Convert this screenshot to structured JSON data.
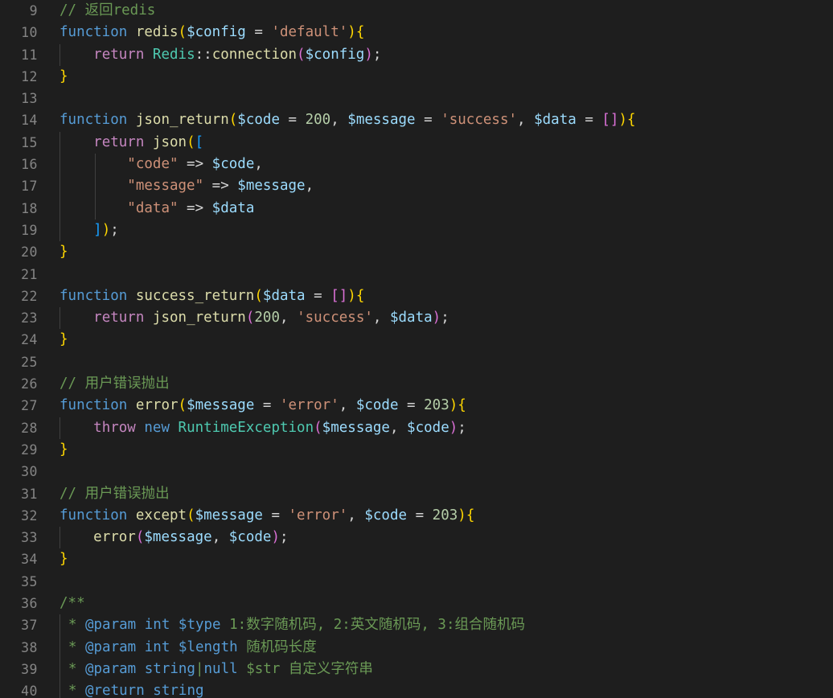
{
  "editor": {
    "language": "php",
    "theme": "Dark Modern",
    "background_color": "#1e1e1e",
    "line_number_color": "#858585",
    "indent_guide_color": "#404040",
    "first_visible_line": 9,
    "last_visible_line": 40,
    "bracket_colors": [
      "#ffd700",
      "#da70d6",
      "#179fff"
    ],
    "token_colors": {
      "comment": "#6a9955",
      "keyword": "#569cd6",
      "control": "#c586c0",
      "function": "#dcdcaa",
      "class": "#4ec9b0",
      "variable": "#9cdcfe",
      "string": "#ce9178",
      "number": "#b5cea8",
      "plain": "#d4d4d4"
    }
  },
  "lines": [
    {
      "num": "9",
      "indent": 0,
      "tokens": [
        {
          "c": "t-comment",
          "t": "// 返回redis"
        }
      ]
    },
    {
      "num": "10",
      "indent": 0,
      "tokens": [
        {
          "c": "t-keyword",
          "t": "function"
        },
        {
          "c": "t-plain",
          "t": " "
        },
        {
          "c": "t-func",
          "t": "redis"
        },
        {
          "c": "b1",
          "t": "("
        },
        {
          "c": "t-var",
          "t": "$config"
        },
        {
          "c": "t-plain",
          "t": " = "
        },
        {
          "c": "t-string",
          "t": "'default'"
        },
        {
          "c": "b1",
          "t": ")"
        },
        {
          "c": "b1",
          "t": "{"
        }
      ]
    },
    {
      "num": "11",
      "indent": 1,
      "tokens": [
        {
          "c": "t-plain",
          "t": "    "
        },
        {
          "c": "t-control",
          "t": "return"
        },
        {
          "c": "t-plain",
          "t": " "
        },
        {
          "c": "t-class",
          "t": "Redis"
        },
        {
          "c": "t-plain",
          "t": "::"
        },
        {
          "c": "t-func",
          "t": "connection"
        },
        {
          "c": "b2",
          "t": "("
        },
        {
          "c": "t-var",
          "t": "$config"
        },
        {
          "c": "b2",
          "t": ")"
        },
        {
          "c": "t-plain",
          "t": ";"
        }
      ]
    },
    {
      "num": "12",
      "indent": 0,
      "tokens": [
        {
          "c": "b1",
          "t": "}"
        }
      ]
    },
    {
      "num": "13",
      "indent": 0,
      "tokens": []
    },
    {
      "num": "14",
      "indent": 0,
      "tokens": [
        {
          "c": "t-keyword",
          "t": "function"
        },
        {
          "c": "t-plain",
          "t": " "
        },
        {
          "c": "t-func",
          "t": "json_return"
        },
        {
          "c": "b1",
          "t": "("
        },
        {
          "c": "t-var",
          "t": "$code"
        },
        {
          "c": "t-plain",
          "t": " = "
        },
        {
          "c": "t-number",
          "t": "200"
        },
        {
          "c": "t-plain",
          "t": ", "
        },
        {
          "c": "t-var",
          "t": "$message"
        },
        {
          "c": "t-plain",
          "t": " = "
        },
        {
          "c": "t-string",
          "t": "'success'"
        },
        {
          "c": "t-plain",
          "t": ", "
        },
        {
          "c": "t-var",
          "t": "$data"
        },
        {
          "c": "t-plain",
          "t": " = "
        },
        {
          "c": "b2",
          "t": "[]"
        },
        {
          "c": "b1",
          "t": ")"
        },
        {
          "c": "b1",
          "t": "{"
        }
      ]
    },
    {
      "num": "15",
      "indent": 1,
      "tokens": [
        {
          "c": "t-plain",
          "t": "    "
        },
        {
          "c": "t-control",
          "t": "return"
        },
        {
          "c": "t-plain",
          "t": " "
        },
        {
          "c": "t-func",
          "t": "json"
        },
        {
          "c": "b1",
          "t": "("
        },
        {
          "c": "b3",
          "t": "["
        }
      ]
    },
    {
      "num": "16",
      "indent": 2,
      "tokens": [
        {
          "c": "t-plain",
          "t": "        "
        },
        {
          "c": "t-string",
          "t": "\"code\""
        },
        {
          "c": "t-plain",
          "t": " => "
        },
        {
          "c": "t-var",
          "t": "$code"
        },
        {
          "c": "t-plain",
          "t": ","
        }
      ]
    },
    {
      "num": "17",
      "indent": 2,
      "tokens": [
        {
          "c": "t-plain",
          "t": "        "
        },
        {
          "c": "t-string",
          "t": "\"message\""
        },
        {
          "c": "t-plain",
          "t": " => "
        },
        {
          "c": "t-var",
          "t": "$message"
        },
        {
          "c": "t-plain",
          "t": ","
        }
      ]
    },
    {
      "num": "18",
      "indent": 2,
      "tokens": [
        {
          "c": "t-plain",
          "t": "        "
        },
        {
          "c": "t-string",
          "t": "\"data\""
        },
        {
          "c": "t-plain",
          "t": " => "
        },
        {
          "c": "t-var",
          "t": "$data"
        }
      ]
    },
    {
      "num": "19",
      "indent": 1,
      "tokens": [
        {
          "c": "t-plain",
          "t": "    "
        },
        {
          "c": "b3",
          "t": "]"
        },
        {
          "c": "b1",
          "t": ")"
        },
        {
          "c": "t-plain",
          "t": ";"
        }
      ]
    },
    {
      "num": "20",
      "indent": 0,
      "tokens": [
        {
          "c": "b1",
          "t": "}"
        }
      ]
    },
    {
      "num": "21",
      "indent": 0,
      "tokens": []
    },
    {
      "num": "22",
      "indent": 0,
      "tokens": [
        {
          "c": "t-keyword",
          "t": "function"
        },
        {
          "c": "t-plain",
          "t": " "
        },
        {
          "c": "t-func",
          "t": "success_return"
        },
        {
          "c": "b1",
          "t": "("
        },
        {
          "c": "t-var",
          "t": "$data"
        },
        {
          "c": "t-plain",
          "t": " = "
        },
        {
          "c": "b2",
          "t": "[]"
        },
        {
          "c": "b1",
          "t": ")"
        },
        {
          "c": "b1",
          "t": "{"
        }
      ]
    },
    {
      "num": "23",
      "indent": 1,
      "tokens": [
        {
          "c": "t-plain",
          "t": "    "
        },
        {
          "c": "t-control",
          "t": "return"
        },
        {
          "c": "t-plain",
          "t": " "
        },
        {
          "c": "t-func",
          "t": "json_return"
        },
        {
          "c": "b2",
          "t": "("
        },
        {
          "c": "t-number",
          "t": "200"
        },
        {
          "c": "t-plain",
          "t": ", "
        },
        {
          "c": "t-string",
          "t": "'success'"
        },
        {
          "c": "t-plain",
          "t": ", "
        },
        {
          "c": "t-var",
          "t": "$data"
        },
        {
          "c": "b2",
          "t": ")"
        },
        {
          "c": "t-plain",
          "t": ";"
        }
      ]
    },
    {
      "num": "24",
      "indent": 0,
      "tokens": [
        {
          "c": "b1",
          "t": "}"
        }
      ]
    },
    {
      "num": "25",
      "indent": 0,
      "tokens": []
    },
    {
      "num": "26",
      "indent": 0,
      "tokens": [
        {
          "c": "t-comment",
          "t": "// 用户错误抛出"
        }
      ]
    },
    {
      "num": "27",
      "indent": 0,
      "tokens": [
        {
          "c": "t-keyword",
          "t": "function"
        },
        {
          "c": "t-plain",
          "t": " "
        },
        {
          "c": "t-func",
          "t": "error"
        },
        {
          "c": "b1",
          "t": "("
        },
        {
          "c": "t-var",
          "t": "$message"
        },
        {
          "c": "t-plain",
          "t": " = "
        },
        {
          "c": "t-string",
          "t": "'error'"
        },
        {
          "c": "t-plain",
          "t": ", "
        },
        {
          "c": "t-var",
          "t": "$code"
        },
        {
          "c": "t-plain",
          "t": " = "
        },
        {
          "c": "t-number",
          "t": "203"
        },
        {
          "c": "b1",
          "t": ")"
        },
        {
          "c": "b1",
          "t": "{"
        }
      ]
    },
    {
      "num": "28",
      "indent": 1,
      "tokens": [
        {
          "c": "t-plain",
          "t": "    "
        },
        {
          "c": "t-control",
          "t": "throw"
        },
        {
          "c": "t-plain",
          "t": " "
        },
        {
          "c": "t-keyword",
          "t": "new"
        },
        {
          "c": "t-plain",
          "t": " "
        },
        {
          "c": "t-class",
          "t": "RuntimeException"
        },
        {
          "c": "b2",
          "t": "("
        },
        {
          "c": "t-var",
          "t": "$message"
        },
        {
          "c": "t-plain",
          "t": ", "
        },
        {
          "c": "t-var",
          "t": "$code"
        },
        {
          "c": "b2",
          "t": ")"
        },
        {
          "c": "t-plain",
          "t": ";"
        }
      ]
    },
    {
      "num": "29",
      "indent": 0,
      "tokens": [
        {
          "c": "b1",
          "t": "}"
        }
      ]
    },
    {
      "num": "30",
      "indent": 0,
      "tokens": []
    },
    {
      "num": "31",
      "indent": 0,
      "tokens": [
        {
          "c": "t-comment",
          "t": "// 用户错误抛出"
        }
      ]
    },
    {
      "num": "32",
      "indent": 0,
      "tokens": [
        {
          "c": "t-keyword",
          "t": "function"
        },
        {
          "c": "t-plain",
          "t": " "
        },
        {
          "c": "t-func",
          "t": "except"
        },
        {
          "c": "b1",
          "t": "("
        },
        {
          "c": "t-var",
          "t": "$message"
        },
        {
          "c": "t-plain",
          "t": " = "
        },
        {
          "c": "t-string",
          "t": "'error'"
        },
        {
          "c": "t-plain",
          "t": ", "
        },
        {
          "c": "t-var",
          "t": "$code"
        },
        {
          "c": "t-plain",
          "t": " = "
        },
        {
          "c": "t-number",
          "t": "203"
        },
        {
          "c": "b1",
          "t": ")"
        },
        {
          "c": "b1",
          "t": "{"
        }
      ]
    },
    {
      "num": "33",
      "indent": 1,
      "tokens": [
        {
          "c": "t-plain",
          "t": "    "
        },
        {
          "c": "t-func",
          "t": "error"
        },
        {
          "c": "b2",
          "t": "("
        },
        {
          "c": "t-var",
          "t": "$message"
        },
        {
          "c": "t-plain",
          "t": ", "
        },
        {
          "c": "t-var",
          "t": "$code"
        },
        {
          "c": "b2",
          "t": ")"
        },
        {
          "c": "t-plain",
          "t": ";"
        }
      ]
    },
    {
      "num": "34",
      "indent": 0,
      "tokens": [
        {
          "c": "b1",
          "t": "}"
        }
      ]
    },
    {
      "num": "35",
      "indent": 0,
      "tokens": []
    },
    {
      "num": "36",
      "indent": 0,
      "tokens": [
        {
          "c": "t-comment",
          "t": "/**"
        }
      ]
    },
    {
      "num": "37",
      "indent": 0,
      "offset": 1,
      "tokens": [
        {
          "c": "t-comment",
          "t": "* "
        },
        {
          "c": "t-doctag",
          "t": "@param"
        },
        {
          "c": "t-comment",
          "t": " "
        },
        {
          "c": "t-keyword",
          "t": "int"
        },
        {
          "c": "t-comment",
          "t": " "
        },
        {
          "c": "t-doctag",
          "t": "$type"
        },
        {
          "c": "t-comment",
          "t": " 1:数字随机码, 2:英文随机码, 3:组合随机码"
        }
      ]
    },
    {
      "num": "38",
      "indent": 0,
      "offset": 1,
      "tokens": [
        {
          "c": "t-comment",
          "t": "* "
        },
        {
          "c": "t-doctag",
          "t": "@param"
        },
        {
          "c": "t-comment",
          "t": " "
        },
        {
          "c": "t-keyword",
          "t": "int"
        },
        {
          "c": "t-comment",
          "t": " "
        },
        {
          "c": "t-doctag",
          "t": "$length"
        },
        {
          "c": "t-comment",
          "t": " 随机码长度"
        }
      ]
    },
    {
      "num": "39",
      "indent": 0,
      "offset": 1,
      "tokens": [
        {
          "c": "t-comment",
          "t": "* "
        },
        {
          "c": "t-doctag",
          "t": "@param"
        },
        {
          "c": "t-comment",
          "t": " "
        },
        {
          "c": "t-keyword",
          "t": "string"
        },
        {
          "c": "t-comment",
          "t": "|"
        },
        {
          "c": "t-keyword",
          "t": "null"
        },
        {
          "c": "t-comment",
          "t": " "
        },
        {
          "c": "t-docvar",
          "t": "$str"
        },
        {
          "c": "t-comment",
          "t": " 自定义字符串"
        }
      ]
    },
    {
      "num": "40",
      "indent": 0,
      "offset": 1,
      "tokens": [
        {
          "c": "t-comment",
          "t": "* "
        },
        {
          "c": "t-doctag",
          "t": "@return"
        },
        {
          "c": "t-comment",
          "t": " "
        },
        {
          "c": "t-keyword",
          "t": "string"
        }
      ]
    }
  ]
}
